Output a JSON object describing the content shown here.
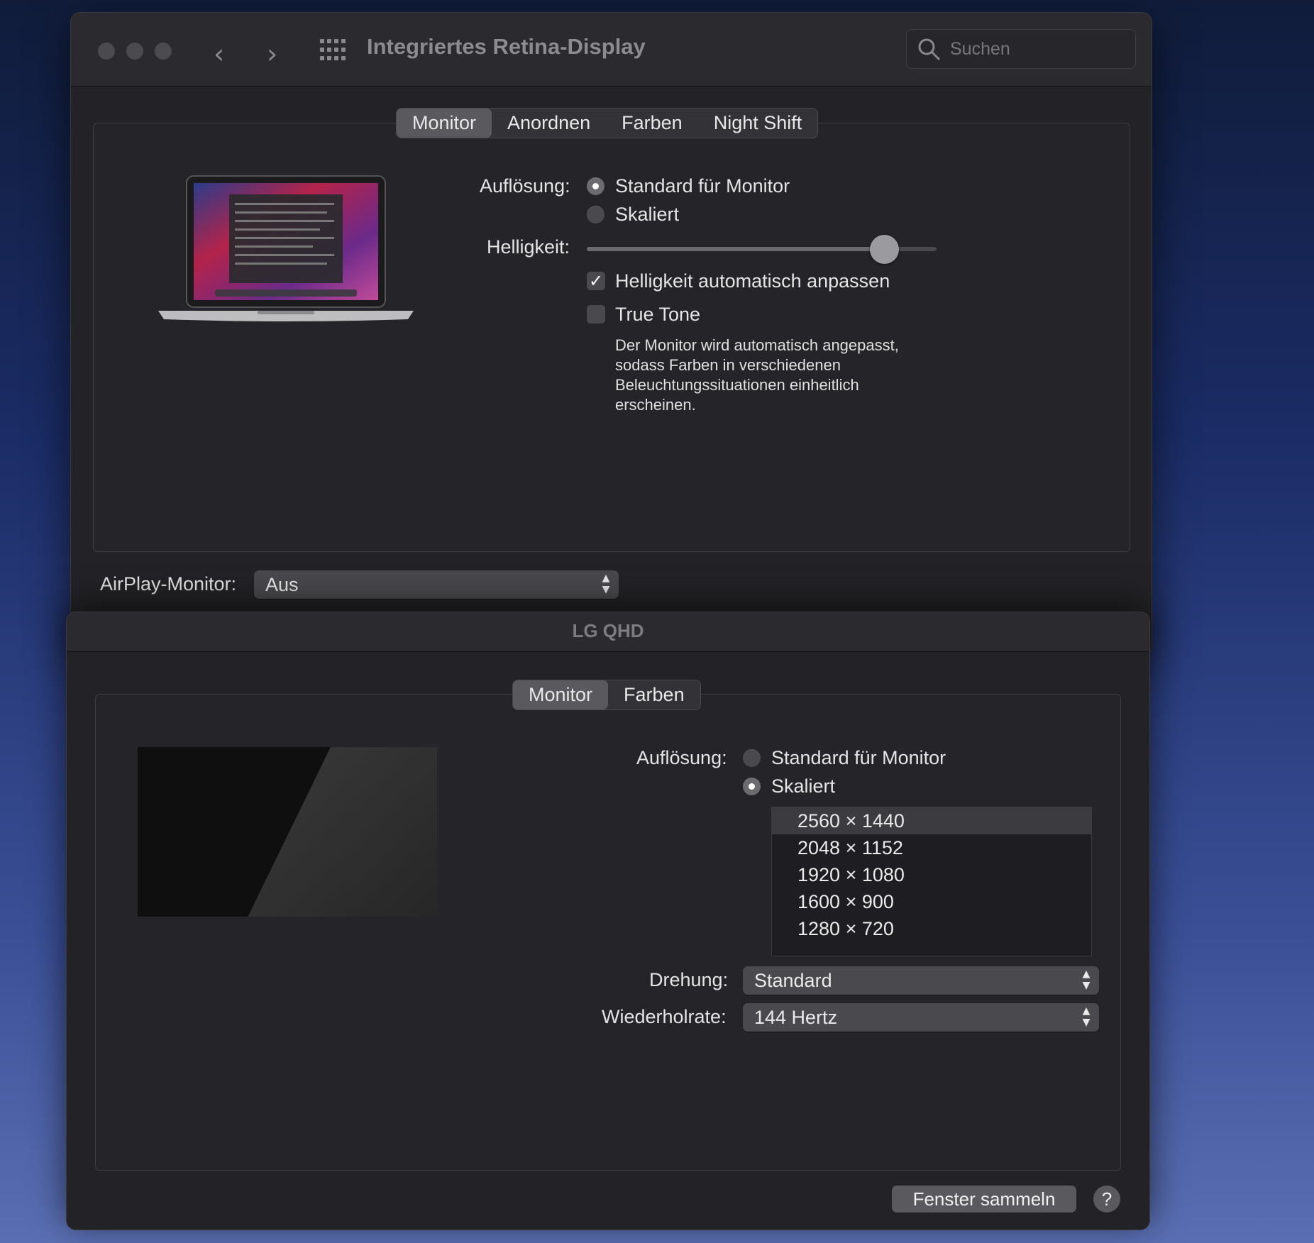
{
  "window_main": {
    "title": "Integriertes Retina-Display",
    "search_placeholder": "Suchen",
    "tabs": [
      "Monitor",
      "Anordnen",
      "Farben",
      "Night Shift"
    ],
    "active_tab": "Monitor",
    "resolution_label": "Auflösung:",
    "resolution_options": [
      "Standard für Monitor",
      "Skaliert"
    ],
    "resolution_selected": "Standard für Monitor",
    "brightness_label": "Helligkeit:",
    "brightness_level": 0.85,
    "auto_brightness_label": "Helligkeit automatisch anpassen",
    "auto_brightness_checked": true,
    "true_tone_label": "True Tone",
    "true_tone_checked": false,
    "true_tone_description": [
      "Der Monitor wird automatisch angepasst,",
      "sodass Farben in verschiedenen",
      "Beleuchtungssituationen einheitlich",
      "erscheinen."
    ],
    "airplay_label": "AirPlay-Monitor:",
    "airplay_value": "Aus"
  },
  "window_lg": {
    "title": "LG QHD",
    "tabs": [
      "Monitor",
      "Farben"
    ],
    "active_tab": "Monitor",
    "resolution_label": "Auflösung:",
    "resolution_options": [
      "Standard für Monitor",
      "Skaliert"
    ],
    "resolution_selected": "Skaliert",
    "scaled_resolutions": [
      "2560 × 1440",
      "2048 × 1152",
      "1920 × 1080",
      "1600 × 900",
      "1280 × 720"
    ],
    "scaled_selected": "2560 × 1440",
    "rotation_label": "Drehung:",
    "rotation_value": "Standard",
    "refresh_label": "Wiederholrate:",
    "refresh_value": "144 Hertz",
    "gather_button": "Fenster sammeln",
    "help_button": "?"
  },
  "colors": {
    "window_bg": "#232327",
    "control": "#4a4a4e",
    "selected_tab": "#5a5a5e"
  }
}
